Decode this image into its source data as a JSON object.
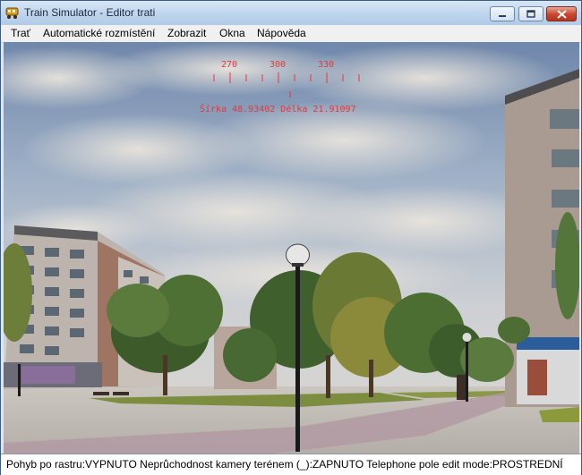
{
  "window": {
    "title": "Train Simulator - Editor trati",
    "icon": "train-app-icon"
  },
  "menu": {
    "items": [
      {
        "label": "Trať"
      },
      {
        "label": "Automatické rozmístění"
      },
      {
        "label": "Zobrazit"
      },
      {
        "label": "Okna"
      },
      {
        "label": "Nápověda"
      }
    ]
  },
  "hud": {
    "compass_labels": [
      "270",
      "300",
      "330"
    ],
    "coordinates": "Šírka 48.93402 Délka 21.91097",
    "color": "#e2393c"
  },
  "status": {
    "text": "Pohyb po rastru:VYPNUTO Neprůchodnost kamery terénem (_):ZAPNUTO Telephone pole edit mode:PROSTREDNÍ"
  },
  "scene": {
    "description_colors": {
      "sky": "#a9b8cb",
      "grass": "#7a8c3e",
      "paving": "#c9c3bd"
    }
  }
}
